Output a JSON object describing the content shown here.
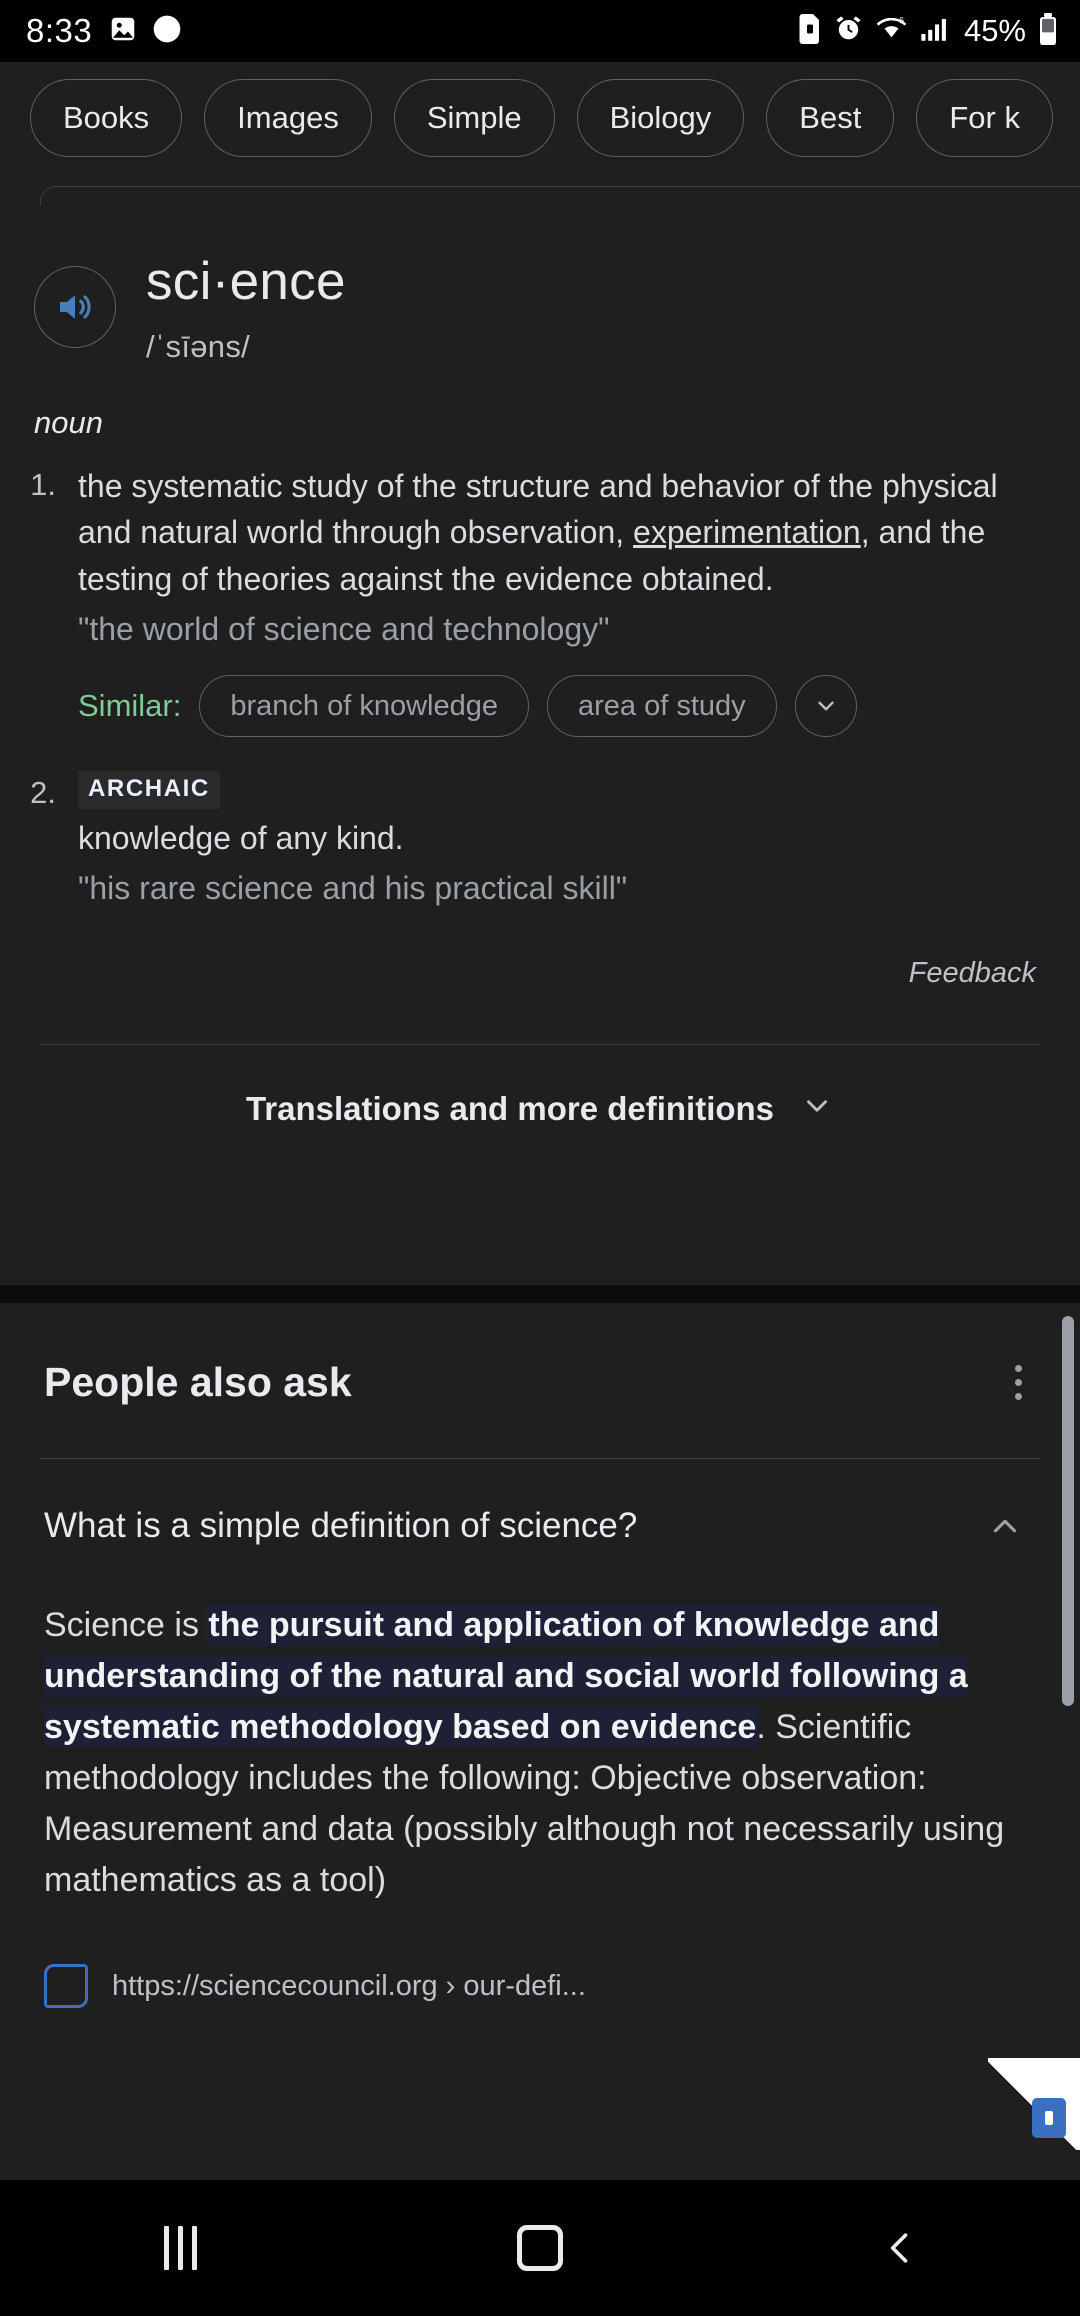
{
  "status_bar": {
    "time": "8:33",
    "left_icons": [
      "image-icon",
      "eclipse-icon"
    ],
    "right_icons": [
      "sd-card-icon",
      "alarm-icon",
      "wifi-icon",
      "signal-icon"
    ],
    "battery_percent": "45%"
  },
  "filter_chips": [
    {
      "label": "Books"
    },
    {
      "label": "Images"
    },
    {
      "label": "Simple"
    },
    {
      "label": "Biology"
    },
    {
      "label": "Best"
    },
    {
      "label": "For k"
    }
  ],
  "dictionary": {
    "headword": "sci·ence",
    "phonetic": "/ˈsīəns/",
    "speaker_icon": "speaker-icon",
    "part_of_speech": "noun",
    "senses": [
      {
        "number": "1.",
        "label": "",
        "definition_before_link": "the systematic study of the structure and behavior of the physical and natural world through observation, ",
        "definition_link": "experimentation",
        "definition_after_link": ", and the testing of theories against the evidence obtained.",
        "example": "\"the world of science and technology\"",
        "similar_label": "Similar:",
        "similar_chips": [
          "branch of knowledge",
          "area of study"
        ],
        "similar_more_icon": "chevron-down-icon"
      },
      {
        "number": "2.",
        "label": "ARCHAIC",
        "definition_before_link": "knowledge of any kind.",
        "definition_link": "",
        "definition_after_link": "",
        "example": "\"his rare science and his practical skill\""
      }
    ],
    "feedback_label": "Feedback",
    "translations_label": "Translations and more definitions",
    "translations_icon": "chevron-down-icon"
  },
  "people_also_ask": {
    "title": "People also ask",
    "menu_icon": "kebab-menu-icon",
    "question": "What is a simple definition of science?",
    "collapse_icon": "chevron-up-icon",
    "answer_prefix": "Science is ",
    "answer_highlight": "the pursuit and application of knowledge and understanding of the natural and social world following a systematic methodology based on evidence",
    "answer_suffix": ". Scientific methodology includes the following: Objective observation: Measurement and data (possibly although not necessarily using mathematics as a tool)",
    "source_url": "https://sciencecouncil.org › our-defi...",
    "favicon": "site-favicon"
  },
  "nav_bar": {
    "recents_icon": "recents-icon",
    "home_icon": "home-icon",
    "back_icon": "back-icon"
  },
  "colors": {
    "background": "#1f1f1f",
    "black": "#000000",
    "text_primary": "#e8eaed",
    "text_secondary": "#bdc1c6",
    "text_muted": "#9aa0a6",
    "similar_green": "#81c995",
    "link_blue": "#8ab4f8",
    "speaker_blue": "#4a7ebb",
    "highlight_bg": "#1e2036",
    "divider": "#3c4043"
  }
}
